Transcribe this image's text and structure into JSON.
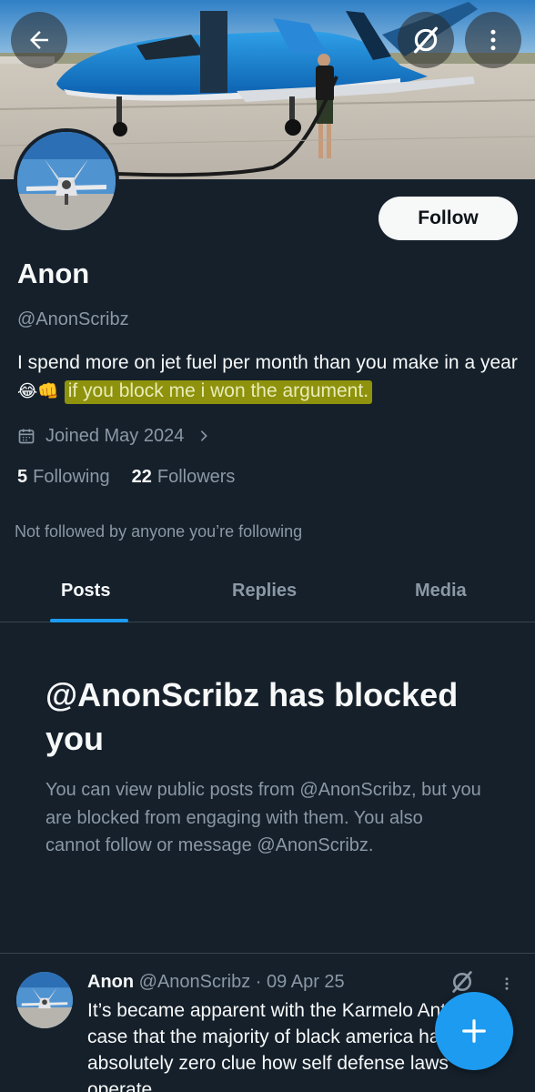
{
  "profile": {
    "name": "Anon",
    "handle": "@AnonScribz",
    "bio_plain": "I spend more on jet fuel per month than you make in a year",
    "bio_emoji": "😂👊",
    "bio_highlight": "if you block me i won the argument.",
    "joined": "Joined May 2024",
    "following_count": "5",
    "following_label": "Following",
    "followers_count": "22",
    "followers_label": "Followers",
    "not_followed": "Not followed by anyone you’re following"
  },
  "actions": {
    "follow_label": "Follow"
  },
  "icons": {
    "back": "back-arrow-icon",
    "grok": "grok-icon",
    "more": "more-vertical-icon",
    "calendar": "calendar-icon",
    "chevron": "chevron-right-icon",
    "compose": "plus-icon"
  },
  "tabs": [
    {
      "label": "Posts",
      "active": true
    },
    {
      "label": "Replies",
      "active": false
    },
    {
      "label": "Media",
      "active": false
    }
  ],
  "blocked": {
    "title": "@AnonScribz has blocked you",
    "description": "You can view public posts from @AnonScribz, but you are blocked from engaging with them. You also cannot follow or message @AnonScribz."
  },
  "post": {
    "name": "Anon",
    "handle": "@AnonScribz",
    "separator": "·",
    "date": "09 Apr 25",
    "text": "It’s became apparent with the Karmelo Anthony case that the majority of black america has absolutely zero clue how self defense laws operate."
  },
  "colors": {
    "background": "#15202b",
    "accent": "#1d9bf0",
    "secondary_text": "#8b98a5",
    "highlight": "#bebe00",
    "divider": "#38444d"
  }
}
